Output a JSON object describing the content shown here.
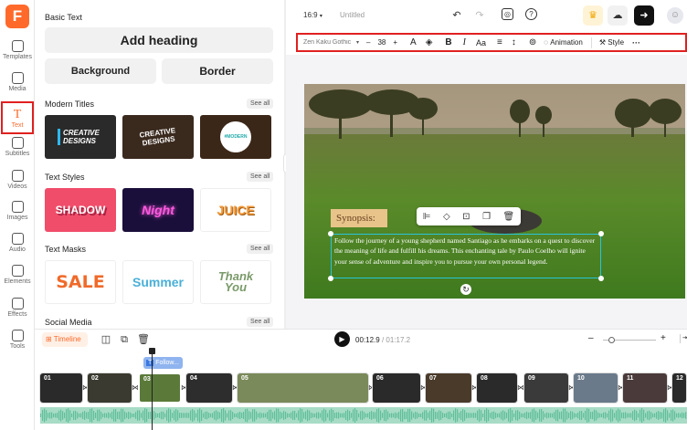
{
  "app": {
    "logo_letter": "F"
  },
  "rail": [
    {
      "label": "Templates",
      "icon": "templates-icon"
    },
    {
      "label": "Media",
      "icon": "media-icon"
    },
    {
      "label": "Text",
      "icon": "text-icon",
      "active": true
    },
    {
      "label": "Subtitles",
      "icon": "subtitles-icon"
    },
    {
      "label": "Videos",
      "icon": "videos-icon"
    },
    {
      "label": "Images",
      "icon": "images-icon"
    },
    {
      "label": "Audio",
      "icon": "audio-icon"
    },
    {
      "label": "Elements",
      "icon": "elements-icon"
    },
    {
      "label": "Effects",
      "icon": "effects-icon"
    },
    {
      "label": "Tools",
      "icon": "tools-icon"
    }
  ],
  "panel": {
    "basic_text": "Basic Text",
    "add_heading": "Add heading",
    "background": "Background",
    "border": "Border",
    "modern_titles": "Modern Titles",
    "text_styles": "Text Styles",
    "text_masks": "Text Masks",
    "social_media": "Social Media",
    "see_all": "See all",
    "modern_thumbs": [
      "CREATIVE DESIGNS",
      "CREATIVE DESIGNS",
      "#MODERN"
    ],
    "style_thumbs": [
      "SHADOW",
      "Night",
      "JUICE"
    ],
    "mask_thumbs": [
      "SALE",
      "Summer",
      "Thank You"
    ]
  },
  "topbar": {
    "ratio": "16:9",
    "title": "Untitled"
  },
  "toolbar": {
    "font": "Zen Kaku Gothic",
    "size": "38",
    "minus": "–",
    "plus": "+",
    "italic": "I",
    "bold": "B",
    "case": "Aa",
    "animation": "Animation",
    "style": "Style",
    "more": "···"
  },
  "canvas": {
    "synopsis": "Synopsis:",
    "paragraph": "Follow the journey of a young shepherd named Santiago as he embarks on a quest to discover the meaning of life and fulfill his dreams. This enchanting tale by Paulo Coelho will ignite your sense of adventure and inspire you to pursue your own personal legend."
  },
  "timeline": {
    "label": "Timeline",
    "current": "00:12.9",
    "total": "/ 01:17.2",
    "text_clip": "Follow...",
    "clips": [
      "01",
      "02",
      "03",
      "04",
      "05",
      "06",
      "07",
      "08",
      "09",
      "10",
      "11",
      "12"
    ],
    "zoom_minus": "–",
    "zoom_plus": "+"
  }
}
